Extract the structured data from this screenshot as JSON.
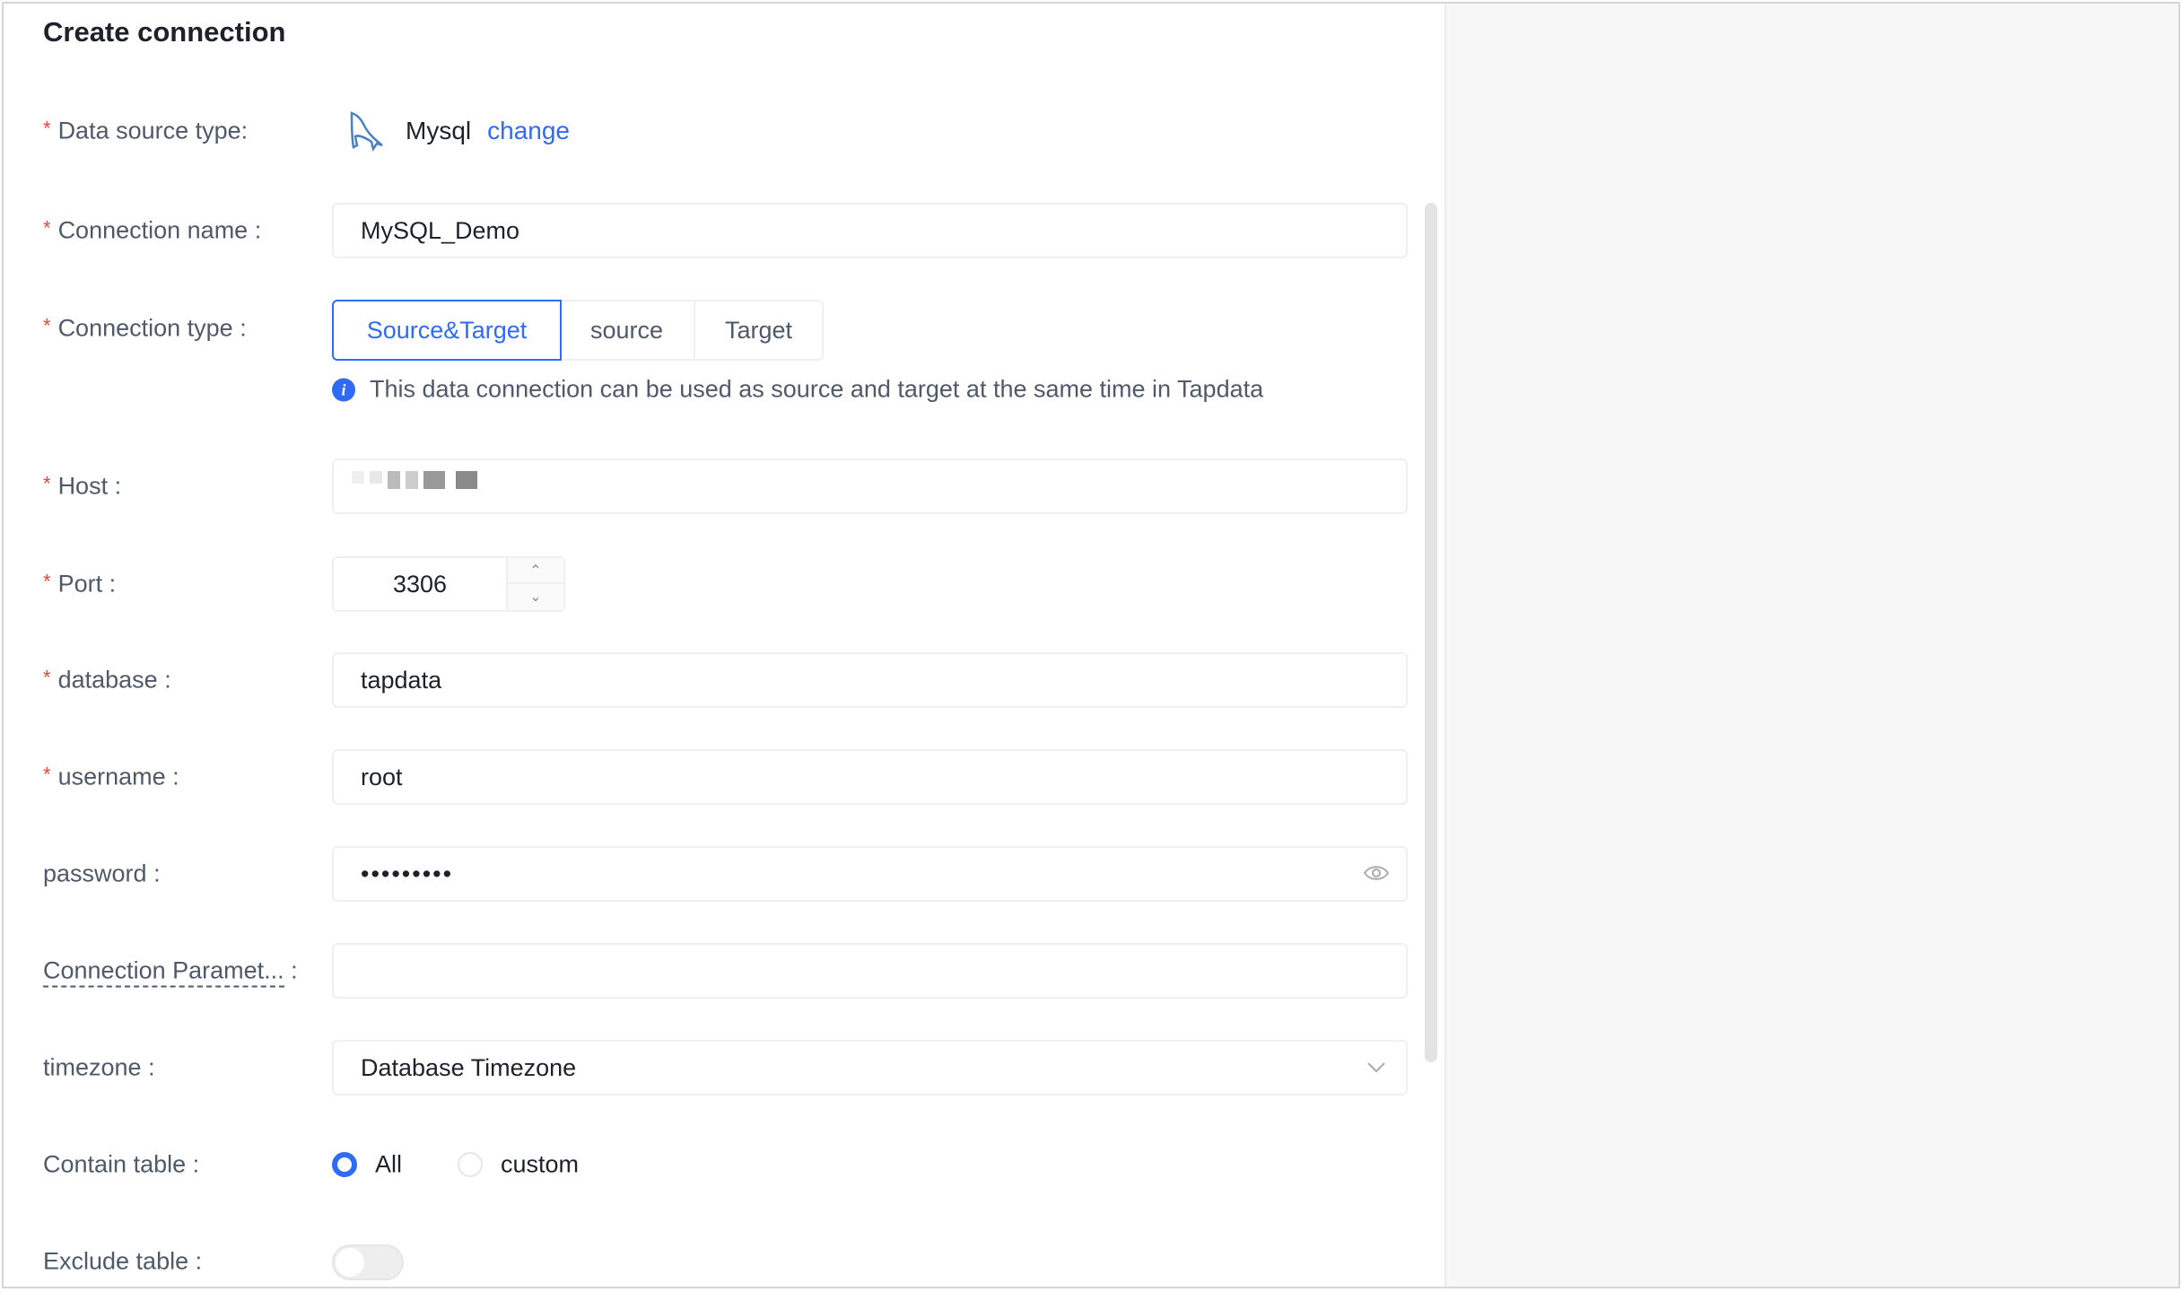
{
  "title": "Create connection",
  "fields": {
    "data_source_type": {
      "label": "Data source type:",
      "value": "Mysql",
      "action": "change"
    },
    "connection_name": {
      "label": "Connection name",
      "value": "MySQL_Demo"
    },
    "connection_type": {
      "label": "Connection type",
      "options": [
        "Source&Target",
        "source",
        "Target"
      ],
      "selected": "Source&Target",
      "info": "This data connection can be used as source and target at the same time in Tapdata"
    },
    "host": {
      "label": "Host"
    },
    "port": {
      "label": "Port",
      "value": "3306"
    },
    "database": {
      "label": "database",
      "value": "tapdata"
    },
    "username": {
      "label": "username",
      "value": "root"
    },
    "password": {
      "label": "password",
      "value": "•••••••••"
    },
    "connection_params": {
      "label": "Connection Paramet...",
      "value": ""
    },
    "timezone": {
      "label": "timezone",
      "value": "Database Timezone"
    },
    "contain_table": {
      "label": "Contain table",
      "options": [
        "All",
        "custom"
      ],
      "selected": "All"
    },
    "exclude_table": {
      "label": "Exclude table",
      "enabled": false
    }
  },
  "colon": ":",
  "colors": {
    "accent": "#2f6bf4",
    "required": "#f53f3f"
  }
}
